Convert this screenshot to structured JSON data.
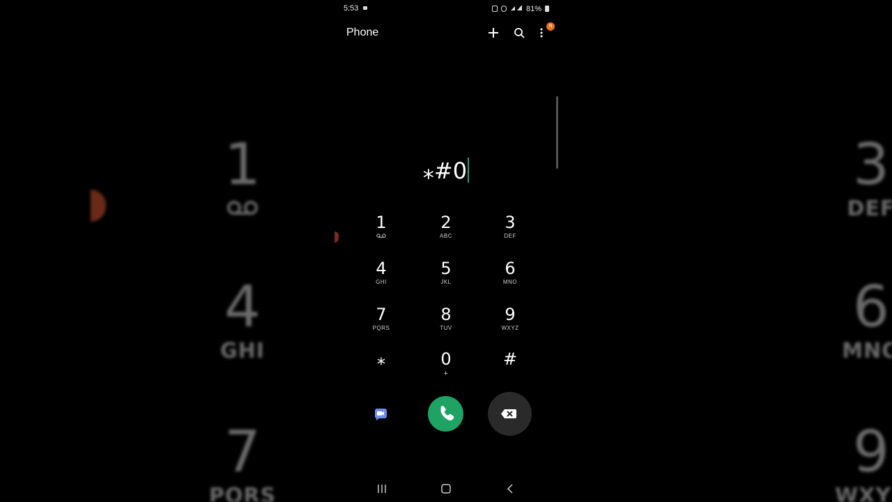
{
  "status_bar": {
    "time": "5:53",
    "battery": "81%"
  },
  "app_bar": {
    "title": "Phone"
  },
  "dialer": {
    "entry": "⁎#0",
    "keys": [
      {
        "digit": "1",
        "sub": "voicemail"
      },
      {
        "digit": "2",
        "sub": "ABC"
      },
      {
        "digit": "3",
        "sub": "DEF"
      },
      {
        "digit": "4",
        "sub": "GHI"
      },
      {
        "digit": "5",
        "sub": "JKL"
      },
      {
        "digit": "6",
        "sub": "MNO"
      },
      {
        "digit": "7",
        "sub": "PQRS"
      },
      {
        "digit": "8",
        "sub": "TUV"
      },
      {
        "digit": "9",
        "sub": "WXYZ"
      },
      {
        "digit": "⁎",
        "sub": ""
      },
      {
        "digit": "0",
        "sub": "+"
      },
      {
        "digit": "#",
        "sub": ""
      }
    ]
  },
  "background": {
    "left": [
      {
        "digit": "1",
        "sub": ""
      },
      {
        "digit": "4",
        "sub": "GHI"
      },
      {
        "digit": "7",
        "sub": "PQRS"
      }
    ],
    "right": [
      {
        "digit": "3",
        "sub": "DEF"
      },
      {
        "digit": "6",
        "sub": "MNO"
      },
      {
        "digit": "9",
        "sub": "WXYZ"
      }
    ]
  },
  "colors": {
    "call": "#1ea365",
    "cursor": "#25a06f",
    "badge": "#e8711f"
  }
}
